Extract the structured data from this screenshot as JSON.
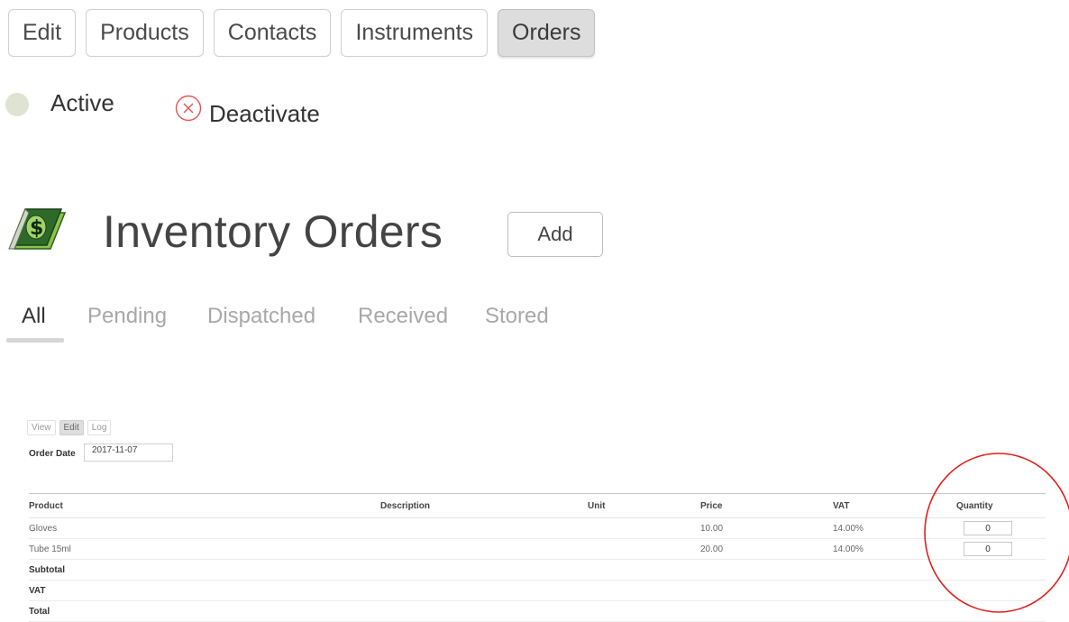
{
  "top_tabs": [
    {
      "label": "Edit",
      "active": false
    },
    {
      "label": "Products",
      "active": false
    },
    {
      "label": "Contacts",
      "active": false
    },
    {
      "label": "Instruments",
      "active": false
    },
    {
      "label": "Orders",
      "active": true
    }
  ],
  "status": {
    "label": "Active",
    "action_label": "Deactivate",
    "dot_color": "#dfe3d1",
    "action_color": "#e05555"
  },
  "header": {
    "title": "Inventory Orders",
    "add_label": "Add",
    "icon": "money-book-icon"
  },
  "filter_tabs": [
    {
      "label": "All",
      "active": true
    },
    {
      "label": "Pending",
      "active": false
    },
    {
      "label": "Dispatched",
      "active": false
    },
    {
      "label": "Received",
      "active": false
    },
    {
      "label": "Stored",
      "active": false
    }
  ],
  "order": {
    "mini_tabs": [
      {
        "label": "View",
        "active": false
      },
      {
        "label": "Edit",
        "active": true
      },
      {
        "label": "Log",
        "active": false
      }
    ],
    "date_label": "Order Date",
    "date_value": "2017-11-07",
    "columns": [
      "Product",
      "Description",
      "Unit",
      "Price",
      "VAT",
      "Quantity"
    ],
    "rows": [
      {
        "product": "Gloves",
        "description": "",
        "unit": "",
        "price": "10.00",
        "vat": "14.00%",
        "quantity": "0"
      },
      {
        "product": "Tube 15ml",
        "description": "",
        "unit": "",
        "price": "20.00",
        "vat": "14.00%",
        "quantity": "0"
      }
    ],
    "summary": [
      "Subtotal",
      "VAT",
      "Total"
    ]
  },
  "annotation_color": "#e0201b"
}
